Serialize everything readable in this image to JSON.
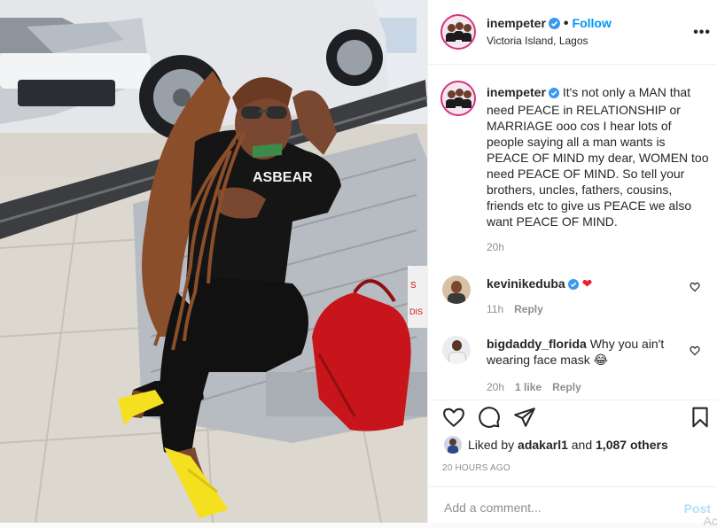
{
  "post": {
    "author": "inempeter",
    "follow_label": "Follow",
    "location": "Victoria Island, Lagos",
    "more_label": "•••",
    "photo_shirt_text": "ASBEAR"
  },
  "caption": {
    "username": "inempeter",
    "text": "It's not only a MAN that need PEACE in RELATIONSHIP or MARRIAGE ooo cos I hear lots of people saying all a man wants is PEACE OF MIND my dear, WOMEN too need PEACE OF MIND. So tell your brothers, uncles, fathers, cousins, friends etc to give us PEACE we also want PEACE OF MIND.",
    "time": "20h"
  },
  "comments": [
    {
      "username": "kevinikeduba",
      "text": "❤",
      "time": "11h",
      "likes": "",
      "reply": "Reply"
    },
    {
      "username": "bigdaddy_florida",
      "text": "Why you ain't wearing face mask 😂",
      "time": "20h",
      "likes": "1 like",
      "reply": "Reply"
    }
  ],
  "likes": {
    "prefix": "Liked by",
    "user": "adakarl1",
    "and": "and",
    "count": "1,087 others"
  },
  "timestamp": "20 HOURS AGO",
  "add_comment": {
    "placeholder": "Add a comment...",
    "post_label": "Post",
    "overflow_text": "Ac"
  },
  "icons": {
    "like": "heart-icon",
    "comment": "comment-icon",
    "share": "share-icon",
    "save": "bookmark-icon",
    "verified": "verified-badge-icon"
  },
  "colors": {
    "accent": "#0095f6",
    "verified": "#3897f0",
    "heart": "#ed1b2e",
    "shoes": "#f5e020",
    "bag": "#c8151b"
  }
}
